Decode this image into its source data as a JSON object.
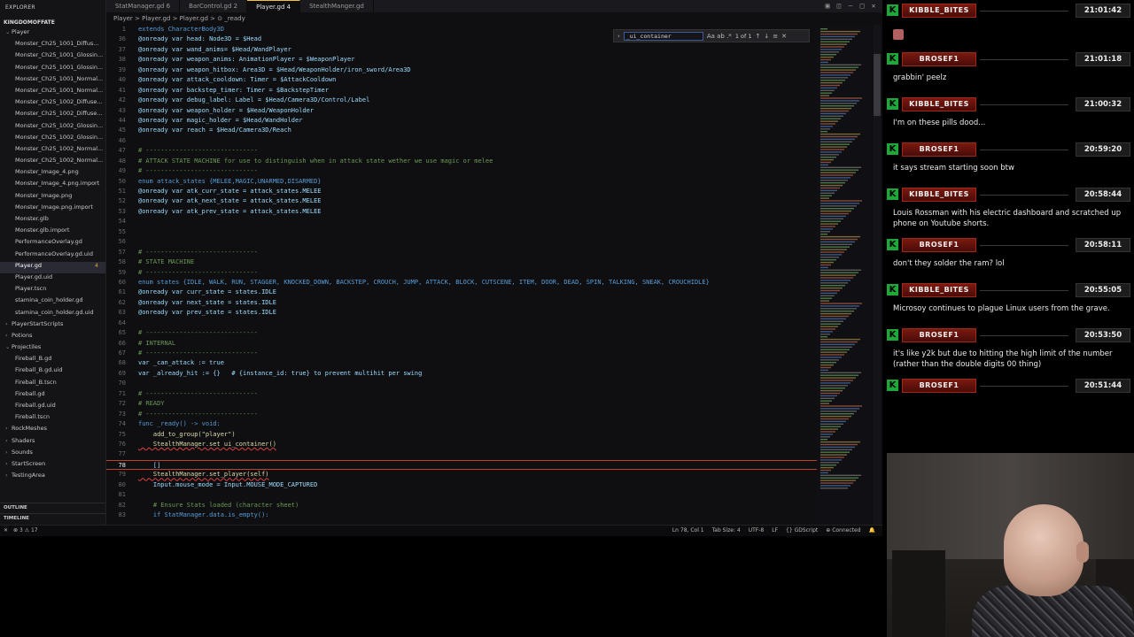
{
  "editor": {
    "tabs": [
      {
        "label": "StatManager.gd 6",
        "active": false
      },
      {
        "label": "BarControl.gd 2",
        "active": false
      },
      {
        "label": "Player.gd 4",
        "active": true
      },
      {
        "label": "StealthManger.gd",
        "active": false
      }
    ],
    "breadcrumb": "Player > Player.gd > Player.gd > ⊙ _ready",
    "explorer_title": "EXPLORER",
    "project_name": "KINGDOMOFFATE",
    "tree": [
      {
        "label": "Player",
        "folder": true
      },
      {
        "label": "Monster_Ch25_1001_Diffus..."
      },
      {
        "label": "Monster_Ch25_1001_Glossin..."
      },
      {
        "label": "Monster_Ch25_1001_Glossin..."
      },
      {
        "label": "Monster_Ch25_1001_Normal..."
      },
      {
        "label": "Monster_Ch25_1001_Normal..."
      },
      {
        "label": "Monster_Ch25_1002_Diffuse..."
      },
      {
        "label": "Monster_Ch25_1002_Diffuse..."
      },
      {
        "label": "Monster_Ch25_1002_Glossin..."
      },
      {
        "label": "Monster_Ch25_1002_Glossin..."
      },
      {
        "label": "Monster_Ch25_1002_Normal..."
      },
      {
        "label": "Monster_Ch25_1002_Normal..."
      },
      {
        "label": "Monster_Image_4.png"
      },
      {
        "label": "Monster_Image_4.png.import"
      },
      {
        "label": "Monster_Image.png"
      },
      {
        "label": "Monster_Image.png.import"
      },
      {
        "label": "Monster.glb"
      },
      {
        "label": "Monster.glb.import"
      },
      {
        "label": "PerformanceOverlay.gd"
      },
      {
        "label": "PerformanceOverlay.gd.uid"
      },
      {
        "label": "Player.gd",
        "selected": true,
        "badge": "4"
      },
      {
        "label": "Player.gd.uid"
      },
      {
        "label": "Player.tscn"
      },
      {
        "label": "stamina_coin_holder.gd"
      },
      {
        "label": "stamina_coin_holder.gd.uid"
      },
      {
        "label": "PlayerStartScripts",
        "folder": true
      },
      {
        "label": "Potions",
        "folder": true
      },
      {
        "label": "Projectiles",
        "folder": true,
        "open": true
      },
      {
        "label": "Fireball_B.gd"
      },
      {
        "label": "Fireball_B.gd.uid"
      },
      {
        "label": "Fireball_B.tscn"
      },
      {
        "label": "Fireball.gd"
      },
      {
        "label": "Fireball.gd.uid"
      },
      {
        "label": "Fireball.tscn"
      },
      {
        "label": "RockMeshes",
        "folder": true
      },
      {
        "label": "Shaders",
        "folder": true
      },
      {
        "label": "Sounds",
        "folder": true
      },
      {
        "label": "StartScreen",
        "folder": true
      },
      {
        "label": "TestingArea",
        "folder": true
      }
    ],
    "outline_label": "OUTLINE",
    "timeline_label": "TIMELINE",
    "find": {
      "value": "_ui_container",
      "option_labels": "Aa ab .*",
      "result": "1 of 1"
    },
    "code_lines": [
      {
        "n": "1",
        "t": "extends CharacterBody3D",
        "k": "kw"
      },
      {
        "n": "36",
        "t": "@onready var head: Node3D = $Head",
        "k": "var"
      },
      {
        "n": "37",
        "t": "@onready var wand_anims= $Head/WandPlayer",
        "k": "var"
      },
      {
        "n": "38",
        "t": "@onready var weapon_anims: AnimationPlayer = $WeaponPlayer",
        "k": "var"
      },
      {
        "n": "39",
        "t": "@onready var weapon_hitbox: Area3D = $Head/WeaponHolder/iron_sword/Area3D",
        "k": "var"
      },
      {
        "n": "40",
        "t": "@onready var attack_cooldown: Timer = $AttackCooldown",
        "k": "var"
      },
      {
        "n": "41",
        "t": "@onready var backstep_timer: Timer = $BackstepTimer",
        "k": "var"
      },
      {
        "n": "42",
        "t": "@onready var debug_label: Label = $Head/Camera3D/Control/Label",
        "k": "var"
      },
      {
        "n": "43",
        "t": "@onready var weapon_holder = $Head/WeaponHolder",
        "k": "var"
      },
      {
        "n": "44",
        "t": "@onready var magic_holder = $Head/WandHolder",
        "k": "var"
      },
      {
        "n": "45",
        "t": "@onready var reach = $Head/Camera3D/Reach",
        "k": "var"
      },
      {
        "n": "46",
        "t": "",
        "k": ""
      },
      {
        "n": "47",
        "t": "# ------------------------------",
        "k": "cm"
      },
      {
        "n": "48",
        "t": "# ATTACK STATE MACHINE for use to distinguish when in attack state wether we use magic or melee",
        "k": "cm"
      },
      {
        "n": "49",
        "t": "# ------------------------------",
        "k": "cm"
      },
      {
        "n": "50",
        "t": "enum attack_states {MELEE,MAGIC,UNARMED,DISARMED}",
        "k": "kw"
      },
      {
        "n": "51",
        "t": "@onready var atk_curr_state = attack_states.MELEE",
        "k": "var"
      },
      {
        "n": "52",
        "t": "@onready var atk_next_state = attack_states.MELEE",
        "k": "var"
      },
      {
        "n": "53",
        "t": "@onready var atk_prev_state = attack_states.MELEE",
        "k": "var"
      },
      {
        "n": "54",
        "t": "",
        "k": ""
      },
      {
        "n": "55",
        "t": "",
        "k": ""
      },
      {
        "n": "56",
        "t": "",
        "k": ""
      },
      {
        "n": "57",
        "t": "# ------------------------------",
        "k": "cm"
      },
      {
        "n": "58",
        "t": "# STATE MACHINE",
        "k": "cm"
      },
      {
        "n": "59",
        "t": "# ------------------------------",
        "k": "cm"
      },
      {
        "n": "60",
        "t": "enum states {IDLE, WALK, RUN, STAGGER, KNOCKED_DOWN, BACKSTEP, CROUCH, JUMP, ATTACK, BLOCK, CUTSCENE, ITEM, DOOR, DEAD, SPIN, TALKING, SNEAK, CROUCHIDLE}",
        "k": "kw"
      },
      {
        "n": "61",
        "t": "@onready var curr_state = states.IDLE",
        "k": "var"
      },
      {
        "n": "62",
        "t": "@onready var next_state = states.IDLE",
        "k": "var"
      },
      {
        "n": "63",
        "t": "@onready var prev_state = states.IDLE",
        "k": "var"
      },
      {
        "n": "64",
        "t": "",
        "k": ""
      },
      {
        "n": "65",
        "t": "# ------------------------------",
        "k": "cm"
      },
      {
        "n": "66",
        "t": "# INTERNAL",
        "k": "cm"
      },
      {
        "n": "67",
        "t": "# ------------------------------",
        "k": "cm"
      },
      {
        "n": "68",
        "t": "var _can_attack := true",
        "k": "var"
      },
      {
        "n": "69",
        "t": "var _already_hit := {}   # {instance_id: true} to prevent multihit per swing",
        "k": "var"
      },
      {
        "n": "70",
        "t": "",
        "k": ""
      },
      {
        "n": "71",
        "t": "# ------------------------------",
        "k": "cm"
      },
      {
        "n": "72",
        "t": "# READY",
        "k": "cm"
      },
      {
        "n": "73",
        "t": "# ------------------------------",
        "k": "cm"
      },
      {
        "n": "74",
        "t": "func _ready() -> void:",
        "k": "kw"
      },
      {
        "n": "75",
        "t": "    add_to_group(\"player\")",
        "k": "fn"
      },
      {
        "n": "76",
        "t": "    StealthManager.set ui_container()",
        "k": "err"
      },
      {
        "n": "77",
        "t": "",
        "k": ""
      },
      {
        "n": "78",
        "t": "    []",
        "k": "cur"
      },
      {
        "n": "79",
        "t": "    StealthManager.set_player(self)",
        "k": "err"
      },
      {
        "n": "80",
        "t": "    Input.mouse_mode = Input.MOUSE_MODE_CAPTURED",
        "k": "var"
      },
      {
        "n": "81",
        "t": "",
        "k": ""
      },
      {
        "n": "82",
        "t": "    # Ensure Stats loaded (character sheet)",
        "k": "cm"
      },
      {
        "n": "83",
        "t": "    if StatManager.data.is_empty():",
        "k": "kw"
      }
    ],
    "status_left": [
      "✕",
      "⊗ 3 ⚠ 17"
    ],
    "status_right": [
      "Ln 78, Col 1",
      "Tab Size: 4",
      "UTF-8",
      "LF",
      "{} GDScript",
      "⊕ Connected",
      "🔔"
    ]
  },
  "chat": {
    "accent_color": "#1fa83a",
    "messages": [
      {
        "user": "KIBBLE_BITES",
        "time": "21:01:42",
        "text": "",
        "emote": true
      },
      {
        "user": "BROSEF1",
        "time": "21:01:18",
        "text": "grabbin' peelz"
      },
      {
        "user": "KIBBLE_BITES",
        "time": "21:00:32",
        "text": "I'm on these pills dood..."
      },
      {
        "user": "BROSEF1",
        "time": "20:59:20",
        "text": "it says stream starting soon btw"
      },
      {
        "user": "KIBBLE_BITES",
        "time": "20:58:44",
        "text": "Louis Rossman with his electric dashboard and scratched up phone on Youtube shorts."
      },
      {
        "user": "BROSEF1",
        "time": "20:58:11",
        "text": "don't they solder the ram? lol"
      },
      {
        "user": "KIBBLE_BITES",
        "time": "20:55:05",
        "text": "Microsoy continues to plague Linux users from the grave."
      },
      {
        "user": "BROSEF1",
        "time": "20:53:50",
        "text": "it's like y2k but due to hitting the high limit of the number (rather than the double digits 00 thing)"
      },
      {
        "user": "BROSEF1",
        "time": "20:51:44",
        "text": ""
      }
    ]
  }
}
